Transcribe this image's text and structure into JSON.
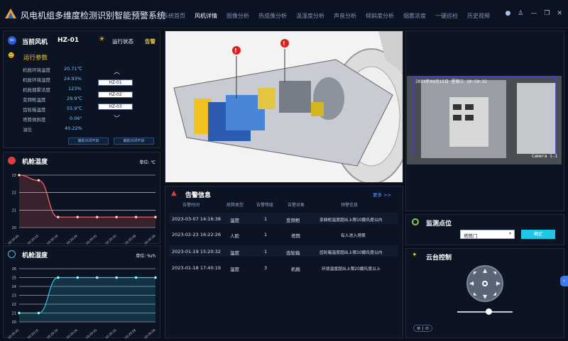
{
  "app": {
    "title": "风电机组多维度检测识别智能预警系统"
  },
  "nav": [
    "系统首页",
    "风机详情",
    "图像分析",
    "热成像分析",
    "温湿度分析",
    "声音分析",
    "倾斜度分析",
    "烟雾浓度",
    "一键巡检",
    "历史视频"
  ],
  "nav_active": 1,
  "status": {
    "badge": "NO",
    "label": "当前风机",
    "turbine": "HZ-01",
    "run_label": "运行状态",
    "run_value": "告警"
  },
  "params": {
    "title": "运行参数",
    "items": [
      {
        "label": "机舱环境温度",
        "value": "20.71℃"
      },
      {
        "label": "机舱环境湿度",
        "value": "24.93%"
      },
      {
        "label": "机舱烟雾浓度",
        "value": "123%"
      },
      {
        "label": "变频柜温度",
        "value": "29.9℃"
      },
      {
        "label": "齿轮箱温度",
        "value": "55.9℃"
      },
      {
        "label": "塔筒倾斜度",
        "value": "0.06°"
      },
      {
        "label": "油位",
        "value": "40.22%"
      }
    ],
    "turbines": [
      "HZ-01",
      "HZ-02",
      "HZ-03"
    ],
    "btn1": "偏航对讲开启",
    "btn2": "偏航对讲开启"
  },
  "temp_chart": {
    "title": "机舱温度",
    "unit": "单位: ℃",
    "chart_data": {
      "type": "area",
      "x": [
        "10:20:45",
        "10:20:15",
        "10:20:10",
        "10:20:24",
        "10:20:25",
        "10:20:25",
        "10:20:28",
        "10:20:28"
      ],
      "values": [
        23,
        22.7,
        20.6,
        20.6,
        20.6,
        20.6,
        20.6,
        20.6
      ],
      "ylim": [
        20,
        23
      ],
      "yticks": [
        "23",
        "22",
        "21",
        "20"
      ],
      "xlabel": "",
      "ylabel": "",
      "grid": true,
      "color": "#ff6a6a"
    }
  },
  "hum_chart": {
    "title": "机舱湿度",
    "unit": "单位: %rh",
    "chart_data": {
      "type": "area",
      "x": [
        "10:20:45",
        "10:20:15",
        "10:20:10",
        "10:20:24",
        "10:20:25",
        "10:20:25",
        "10:20:28",
        "10:20:28"
      ],
      "values": [
        21,
        21,
        25,
        25,
        25,
        25,
        25,
        25
      ],
      "ylim": [
        20,
        26
      ],
      "yticks": [
        "26",
        "25",
        "24",
        "23",
        "22",
        "21",
        "20"
      ],
      "xlabel": "",
      "ylabel": "",
      "grid": true,
      "color": "#36c6e8"
    }
  },
  "alerts": {
    "title": "告警信息",
    "more": "更多 >>",
    "headers": [
      "告警时间",
      "故障类型",
      "告警等级",
      "告警对象",
      "预警信息"
    ],
    "rows": [
      [
        "2023-03-07 14:16:38",
        "温度",
        "1",
        "变频柜",
        "变频柜温度超出上限10摄氏度以内"
      ],
      [
        "2023-02-23 16:22:26",
        "人脸",
        "1",
        "塔筒",
        "有人进入塔筒"
      ],
      [
        "2023-01-19 15:20:32",
        "温度",
        "1",
        "齿轮箱",
        "齿轮箱温度超出上限10摄氏度以内"
      ],
      [
        "2023-01-18 17:40:19",
        "温度",
        "3",
        "机舱",
        "环境温度超出上限20摄氏度以上"
      ]
    ]
  },
  "camera": {
    "timestamp": "2023年03月15日  星期三  10:50:32",
    "label": "Camera  1-1"
  },
  "monitor": {
    "title": "监测点位",
    "selected": "塔筒门",
    "confirm": "确定"
  },
  "ptz": {
    "title": "云台控制",
    "zoom": "⊕ | ⊖"
  }
}
